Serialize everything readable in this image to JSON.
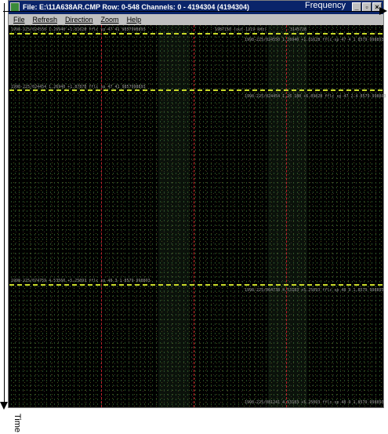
{
  "window": {
    "title": "File: E:\\11A638AR.CMP Row: 0-548 Channels: 0 - 4194304 (4194304)",
    "buttons": {
      "minimize": "_",
      "maximize": "▫",
      "close": "×"
    }
  },
  "menu": [
    "File",
    "Refresh",
    "Direction",
    "Zoom",
    "Help"
  ],
  "axes": {
    "frequency": "Frequency",
    "time": "Time"
  },
  "plot": {
    "top_left": "1998-225/024550  1.26940 +1.8162B fflc sp 47 41 9857998893",
    "top_center": "1987150 (out 1219 kHz)",
    "top_right_num": "3145728",
    "row1_right": "1998-225/024550  1.26940 +1.8162B fflc sp 47 4 1 8579 998893",
    "row1_left": "1998-225/024454  1.26940 +1.8787B fflc sp 47 41 9857998893",
    "row2_right": "1998-225/024454  1.26 180 +6.8982B fflc sp 47 2.4 8579 998893",
    "row3_left": "1998-225/074759  4.53560 +5.25093 fflc sp 48 3 1 8579 998893",
    "row3_right": "1998-225/064738  4.53183 +5.25093 fflc sp 48 9 1.8579 998893",
    "bottom_right": "1998-225/081241  4.53183 +5.25093 fflc sp 48 9 1.8579 998893"
  },
  "colors": {
    "title_bg": "#0a246a",
    "menu_bg": "#c0c0c0",
    "plot_bg": "#000000",
    "divider_yellow": "#c8d828",
    "channel_red": "#c0202a"
  }
}
